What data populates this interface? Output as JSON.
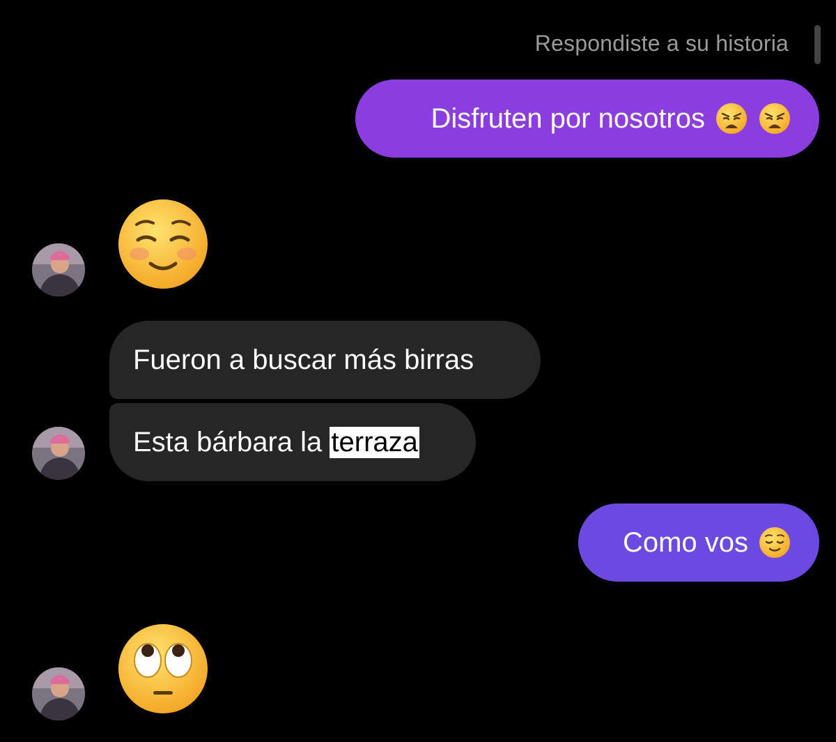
{
  "header": {
    "reply_note": "Respondiste a su historia"
  },
  "messages": [
    {
      "id": "m1",
      "direction": "outgoing",
      "text": "Disfruten por nosotros",
      "emojis": [
        "weary-face-emoji",
        "weary-face-emoji"
      ]
    },
    {
      "id": "m2",
      "direction": "incoming",
      "big_emoji": "smiling-face-emoji"
    },
    {
      "id": "m3",
      "direction": "incoming",
      "text": "Fueron a buscar más birras"
    },
    {
      "id": "m4",
      "direction": "incoming",
      "text_before": "Esta bárbara la ",
      "text_highlighted": "terraza"
    },
    {
      "id": "m5",
      "direction": "outgoing",
      "text": "Como vos",
      "emojis": [
        "relieved-face-emoji"
      ]
    },
    {
      "id": "m6",
      "direction": "incoming",
      "big_emoji": "face-with-rolling-eyes-emoji"
    }
  ],
  "colors": {
    "background": "#000000",
    "outgoing_bubble_1": "#8a3ee0",
    "outgoing_bubble_2": "#6c4ae2",
    "incoming_bubble": "#262626",
    "meta_text": "#9a9a9a",
    "highlight": "#ffffff"
  }
}
